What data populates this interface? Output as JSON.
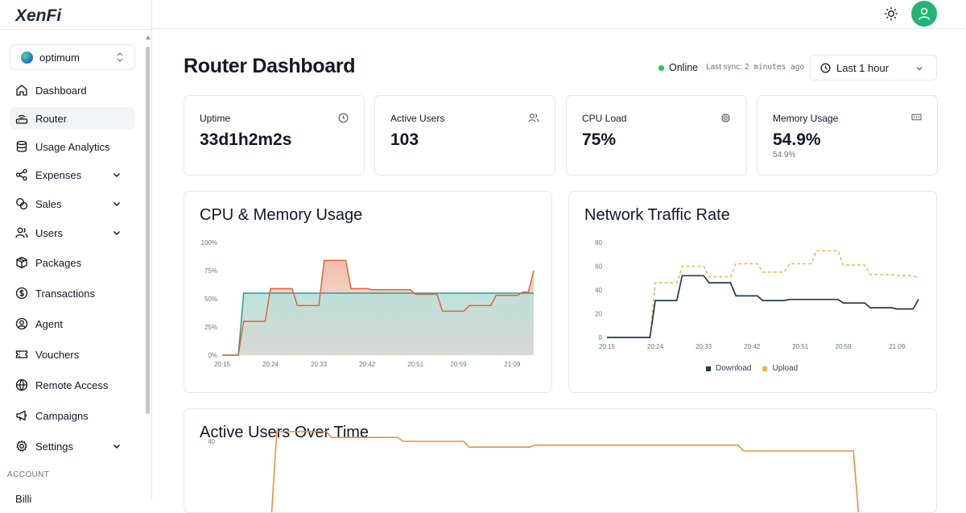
{
  "app": {
    "logo_text": "XenFi"
  },
  "sidebar": {
    "org": "optimum",
    "items": [
      {
        "label": "Dashboard",
        "icon": "home-icon",
        "chevron": false
      },
      {
        "label": "Router",
        "icon": "router-icon",
        "chevron": false,
        "active": true
      },
      {
        "label": "Usage Analytics",
        "icon": "database-icon",
        "chevron": false
      },
      {
        "label": "Expenses",
        "icon": "share-nodes-icon",
        "chevron": true
      },
      {
        "label": "Sales",
        "icon": "coins-icon",
        "chevron": true
      },
      {
        "label": "Users",
        "icon": "users-icon",
        "chevron": true
      },
      {
        "label": "Packages",
        "icon": "package-icon",
        "chevron": false
      },
      {
        "label": "Transactions",
        "icon": "dollar-circle-icon",
        "chevron": false
      },
      {
        "label": "Agent",
        "icon": "user-circle-icon",
        "chevron": false
      },
      {
        "label": "Vouchers",
        "icon": "ticket-icon",
        "chevron": false
      },
      {
        "label": "Remote Access",
        "icon": "globe-icon",
        "chevron": false
      },
      {
        "label": "Campaigns",
        "icon": "megaphone-icon",
        "chevron": false
      },
      {
        "label": "Settings",
        "icon": "gear-icon",
        "chevron": true
      }
    ],
    "account_label": "ACCOUNT",
    "billing_peek": "Billi"
  },
  "header": {
    "title": "Router Dashboard",
    "status": "Online",
    "status_color": "#22c55e",
    "sync_label": "Last sync:",
    "sync_value": "2 minutes ago",
    "range": "Last 1 hour"
  },
  "stats": [
    {
      "label": "Uptime",
      "value": "33d1h2m2s",
      "sub": "",
      "icon": "clock-icon"
    },
    {
      "label": "Active Users",
      "value": "103",
      "sub": "",
      "icon": "users-icon"
    },
    {
      "label": "CPU Load",
      "value": "75%",
      "sub": "",
      "icon": "cpu-icon"
    },
    {
      "label": "Memory Usage",
      "value": "54.9%",
      "sub": "54.9%",
      "icon": "memory-icon"
    }
  ],
  "charts": {
    "cpu_title": "CPU & Memory Usage",
    "network_title": "Network Traffic Rate",
    "users_title": "Active Users Over Time"
  },
  "chart_data": [
    {
      "type": "area",
      "title": "CPU & Memory Usage",
      "x": [
        "20:15",
        "20:16",
        "20:17",
        "20:18",
        "20:19",
        "20:20",
        "20:21",
        "20:22",
        "20:23",
        "20:24",
        "20:25",
        "20:26",
        "20:27",
        "20:28",
        "20:29",
        "20:30",
        "20:31",
        "20:32",
        "20:33",
        "20:34",
        "20:35",
        "20:36",
        "20:37",
        "20:38",
        "20:39",
        "20:40",
        "20:41",
        "20:42",
        "20:43",
        "20:44",
        "20:45",
        "20:46",
        "20:47",
        "20:48",
        "20:49",
        "20:50",
        "20:51",
        "20:52",
        "20:53",
        "20:54",
        "20:55",
        "20:56",
        "20:57",
        "20:58",
        "20:59",
        "21:00",
        "21:01",
        "21:02",
        "21:03",
        "21:04",
        "21:05",
        "21:06",
        "21:07",
        "21:08",
        "21:09",
        "21:10",
        "21:11",
        "21:12",
        "21:13"
      ],
      "xticks": [
        "20:15",
        "20:24",
        "20:33",
        "20:42",
        "20:51",
        "20:59",
        "21:09"
      ],
      "yticks": [
        "0%",
        "25%",
        "50%",
        "75%",
        "100%"
      ],
      "ylim": [
        0,
        100
      ],
      "series": [
        {
          "color": "#e0633a",
          "values": [
            0,
            0,
            0,
            0,
            30,
            30,
            30,
            30,
            30,
            59,
            59,
            59,
            59,
            59,
            44,
            44,
            44,
            44,
            44,
            84,
            84,
            84,
            84,
            84,
            59,
            59,
            59,
            59,
            58,
            58,
            58,
            58,
            58,
            58,
            58,
            58,
            54,
            54,
            54,
            54,
            54,
            39,
            39,
            39,
            39,
            39,
            44,
            44,
            44,
            44,
            44,
            53,
            53,
            53,
            53,
            53,
            56,
            56,
            75
          ]
        },
        {
          "color": "#2f9e8f",
          "values": [
            0,
            0,
            0,
            0,
            55,
            55,
            55,
            55,
            55,
            55,
            55,
            55,
            55,
            55,
            55,
            55,
            55,
            55,
            55,
            55,
            55,
            55,
            55,
            55,
            55,
            55,
            55,
            55,
            55,
            55,
            55,
            55,
            55,
            55,
            55,
            55,
            55,
            55,
            55,
            55,
            55,
            55,
            55,
            55,
            55,
            55,
            55,
            55,
            55,
            55,
            55,
            55,
            55,
            55,
            55,
            55,
            55,
            55,
            55
          ]
        }
      ]
    },
    {
      "type": "line",
      "title": "Network Traffic Rate",
      "x": [
        "20:15",
        "20:16",
        "20:17",
        "20:18",
        "20:19",
        "20:20",
        "20:21",
        "20:22",
        "20:23",
        "20:24",
        "20:25",
        "20:26",
        "20:27",
        "20:28",
        "20:29",
        "20:30",
        "20:31",
        "20:32",
        "20:33",
        "20:34",
        "20:35",
        "20:36",
        "20:37",
        "20:38",
        "20:39",
        "20:40",
        "20:41",
        "20:42",
        "20:43",
        "20:44",
        "20:45",
        "20:46",
        "20:47",
        "20:48",
        "20:49",
        "20:50",
        "20:51",
        "20:52",
        "20:53",
        "20:54",
        "20:55",
        "20:56",
        "20:57",
        "20:58",
        "20:59",
        "21:00",
        "21:01",
        "21:02",
        "21:03",
        "21:04",
        "21:05",
        "21:06",
        "21:07",
        "21:08",
        "21:09",
        "21:10",
        "21:11",
        "21:12",
        "21:13"
      ],
      "xticks": [
        "20:15",
        "20:24",
        "20:33",
        "20:42",
        "20:51",
        "20:59",
        "21:09"
      ],
      "yticks": [
        "0",
        "20",
        "40",
        "60",
        "80"
      ],
      "ylim": [
        0,
        80
      ],
      "series": [
        {
          "name": "Download",
          "color": "#1f3b4d",
          "values": [
            0,
            0,
            0,
            0,
            0,
            0,
            0,
            0,
            0,
            31,
            31,
            31,
            31,
            31,
            52,
            52,
            52,
            52,
            52,
            46,
            46,
            46,
            46,
            46,
            35,
            35,
            35,
            35,
            35,
            31,
            31,
            31,
            31,
            31,
            32,
            32,
            32,
            32,
            32,
            32,
            32,
            32,
            32,
            32,
            29,
            29,
            29,
            29,
            29,
            25,
            25,
            25,
            25,
            25,
            24,
            24,
            24,
            24,
            32
          ]
        },
        {
          "name": "Upload",
          "color": "#e8b84a",
          "values": [
            0,
            0,
            0,
            0,
            0,
            0,
            0,
            0,
            0,
            46,
            46,
            46,
            46,
            46,
            60,
            60,
            60,
            60,
            60,
            51,
            51,
            51,
            51,
            51,
            62,
            62,
            62,
            62,
            62,
            55,
            55,
            55,
            55,
            55,
            62,
            62,
            62,
            62,
            62,
            73,
            73,
            73,
            73,
            73,
            61,
            61,
            61,
            61,
            61,
            53,
            53,
            53,
            53,
            53,
            52,
            52,
            52,
            52,
            50
          ]
        }
      ]
    },
    {
      "type": "line",
      "title": "Active Users Over Time",
      "yticks": [
        "40"
      ],
      "series": [
        {
          "color": "#f28c38",
          "values": [
            0,
            45,
            45,
            45,
            45,
            45,
            45,
            45,
            45,
            45,
            45,
            42,
            42,
            42,
            42,
            42,
            42,
            42,
            42,
            42,
            42,
            42,
            42,
            42,
            40,
            40,
            40,
            40,
            40,
            40,
            40,
            40,
            40,
            40,
            40,
            40,
            37,
            37,
            37,
            37,
            37,
            37,
            37,
            37,
            37,
            37,
            37,
            37,
            38,
            38,
            38,
            38,
            38,
            38,
            38,
            38,
            38,
            38,
            38,
            38,
            38,
            38,
            38,
            38,
            38,
            38,
            38,
            38,
            38,
            38,
            38,
            38,
            38,
            38,
            38,
            38,
            38,
            38,
            38,
            38,
            38,
            38,
            38,
            38,
            38,
            38,
            35,
            35,
            35,
            35,
            35,
            35,
            35,
            35,
            35,
            35,
            35,
            35,
            35,
            35,
            35,
            35,
            35,
            35,
            35,
            35,
            35,
            0
          ]
        }
      ]
    }
  ]
}
